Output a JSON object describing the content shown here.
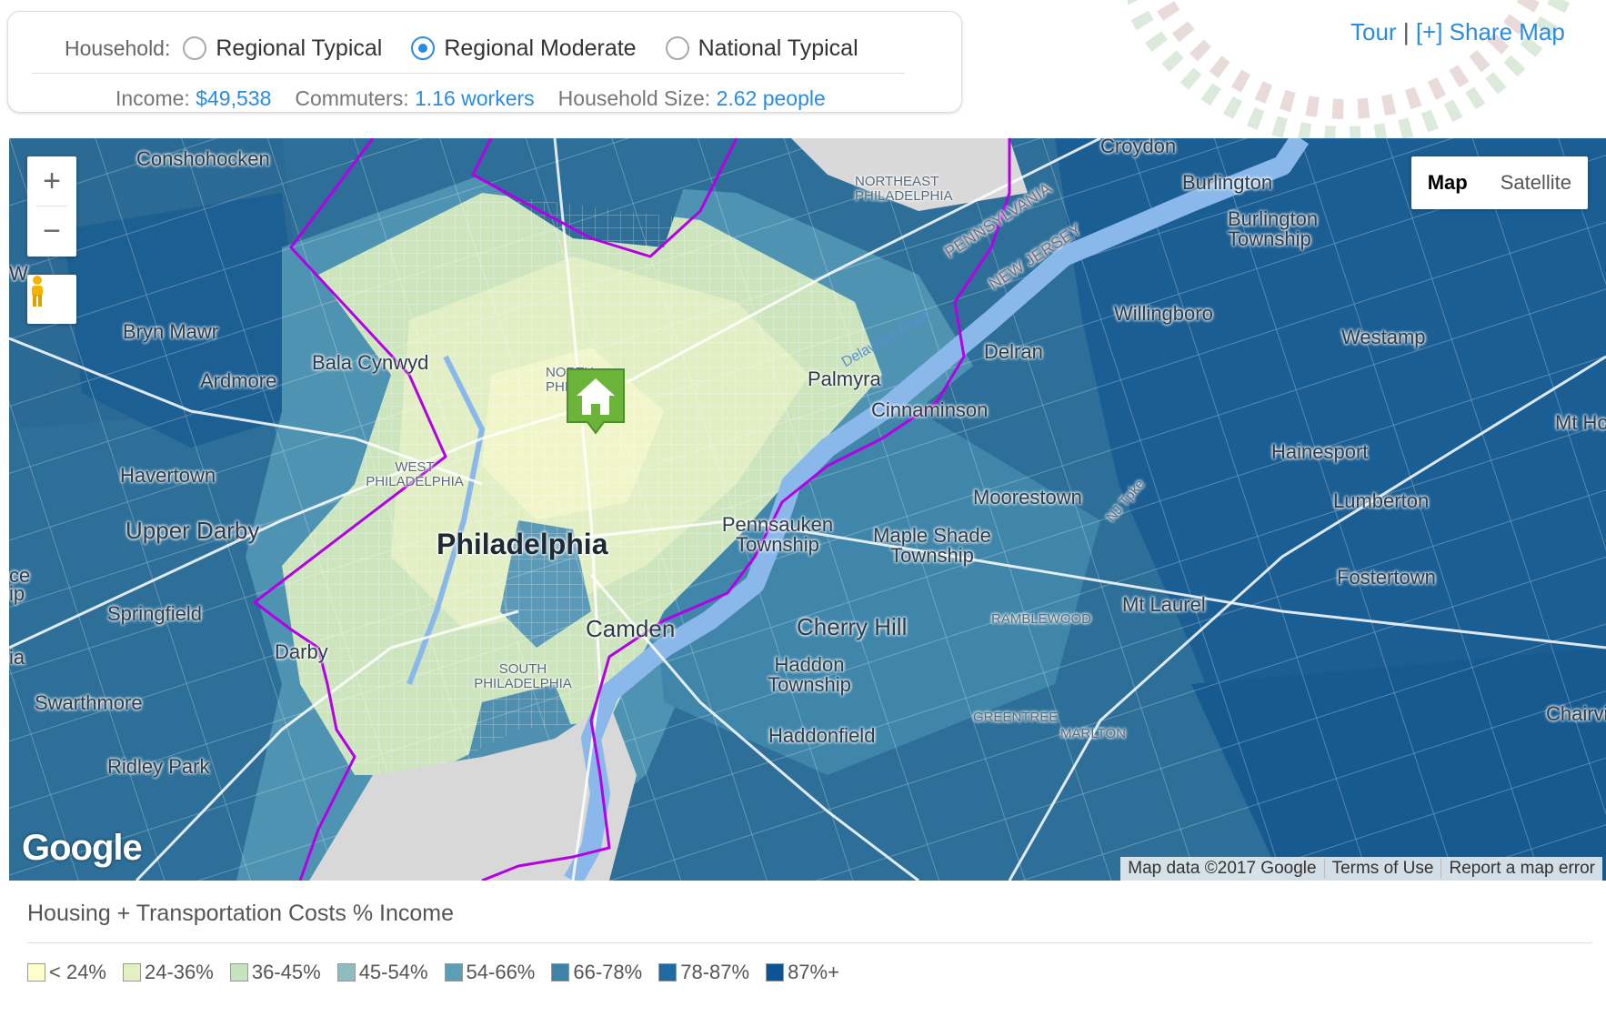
{
  "household": {
    "label": "Household:",
    "options": [
      {
        "label": "Regional Typical",
        "selected": false
      },
      {
        "label": "Regional Moderate",
        "selected": true
      },
      {
        "label": "National Typical",
        "selected": false
      }
    ]
  },
  "stats": {
    "income_label": "Income:",
    "income_value": "$49,538",
    "commuters_label": "Commuters:",
    "commuters_value": "1.16 workers",
    "household_size_label": "Household Size:",
    "household_size_value": "2.62 people"
  },
  "top_links": {
    "tour": "Tour",
    "separator": "|",
    "share": "[+] Share Map"
  },
  "map": {
    "type_control": {
      "map": "Map",
      "satellite": "Satellite",
      "selected": "Map"
    },
    "zoom_in": "+",
    "zoom_out": "−",
    "logo": "Google",
    "attribution": {
      "data": "Map data ©2017 Google",
      "terms": "Terms of Use",
      "report": "Report a map error"
    },
    "labels": {
      "croydon": "Croydon",
      "conshohocken": "Conshohocken",
      "northeast_philadelphia": "NORTHEAST PHILADELPHIA",
      "burlington": "Burlington",
      "burlington_township": "Burlington Township",
      "pennsylvania": "PENNSYLVANIA",
      "new_jersey": "NEW JERSEY",
      "willingboro": "Willingboro",
      "westampton": "Westamp",
      "bryn_mawr": "Bryn Mawr",
      "bala_cynwyd": "Bala Cynwyd",
      "delran": "Delran",
      "ardmore": "Ardmore",
      "north_philadelphia": "NORTH PHILA",
      "palmyra": "Palmyra",
      "delaware_river": "Delaware River",
      "cinnaminson": "Cinnaminson",
      "mt_holly": "Mt Ho",
      "haverton": "Havertown",
      "west_philadelphia": "WEST PHILADELPHIA",
      "hainesport": "Hainesport",
      "moorestown": "Moorestown",
      "lumberton": "Lumberton",
      "upper_darby": "Upper Darby",
      "philadelphia": "Philadelphia",
      "pennsauken": "Pennsauken Township",
      "maple_shade": "Maple Shade Township",
      "fostertown": "Fostertown",
      "springfield": "Springfield",
      "mt_laurel": "Mt Laurel",
      "camden": "Camden",
      "cherry_hill": "Cherry Hill",
      "darby": "Darby",
      "south_philadelphia": "SOUTH PHILADELPHIA",
      "haddon_township": "Haddon Township",
      "swarthmore": "Swarthmore",
      "chairville": "Chairvi",
      "haddonfield": "Haddonfield",
      "ridley_park": "Ridley Park",
      "ramblewood": "RAMBLEWOOD",
      "greentree": "GREENTREE",
      "marlton": "MARLTON",
      "nj_turnpike": "NJ Tpke",
      "edge_w": "W",
      "edge_ce": "ce",
      "edge_ip": "ip",
      "edge_ia": "ia"
    }
  },
  "legend": {
    "title": "Housing + Transportation Costs % Income",
    "items": [
      {
        "label": "< 24%",
        "color": "#ffffcc"
      },
      {
        "label": "24-36%",
        "color": "#e3f0c4"
      },
      {
        "label": "36-45%",
        "color": "#c7e2bf"
      },
      {
        "label": "45-54%",
        "color": "#8fbcbc"
      },
      {
        "label": "54-66%",
        "color": "#5d9db5"
      },
      {
        "label": "66-78%",
        "color": "#3f82a9"
      },
      {
        "label": "78-87%",
        "color": "#1f6aa0"
      },
      {
        "label": "87%+",
        "color": "#0b5594"
      }
    ]
  },
  "colors": {
    "accent": "#2a8ce0",
    "boundary": "#b300e6",
    "marker": "#6ab43a"
  }
}
